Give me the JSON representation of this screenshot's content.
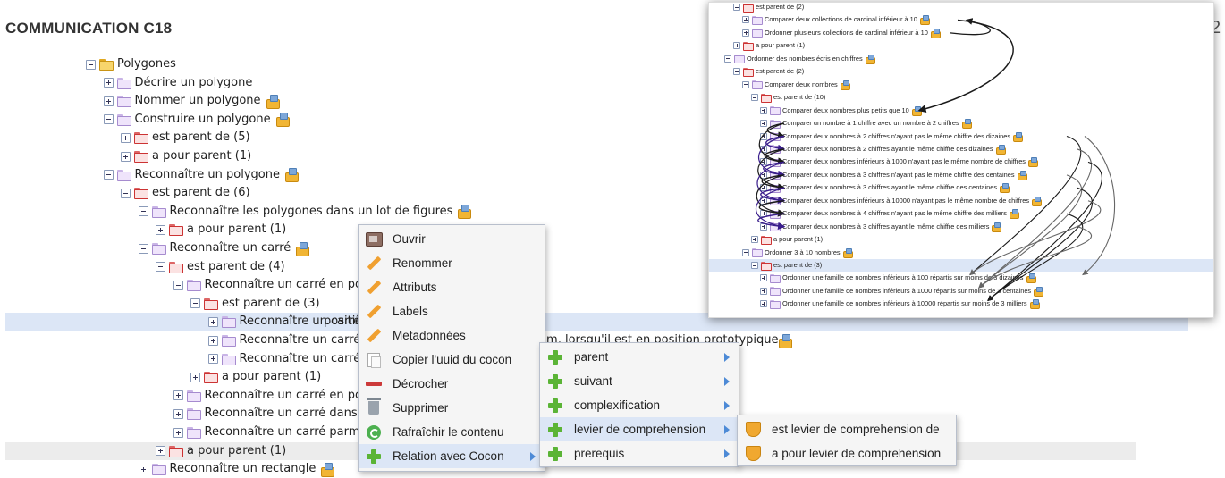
{
  "header": {
    "title": "COMMUNICATION C18",
    "page_number": "2"
  },
  "tree": [
    {
      "label": "Polygones",
      "toggle": "minus",
      "folder": "yellow",
      "badge": false,
      "level": 0
    },
    {
      "label": "Décrire un polygone",
      "toggle": "plus",
      "folder": "lilac",
      "badge": false,
      "level": 1
    },
    {
      "label": "Nommer un polygone",
      "toggle": "plus",
      "folder": "lilac",
      "badge": true,
      "level": 1
    },
    {
      "label": "Construire un polygone",
      "toggle": "minus",
      "folder": "lilac",
      "badge": true,
      "level": 1
    },
    {
      "label": "est parent de (5)",
      "toggle": "plus",
      "folder": "red",
      "badge": false,
      "level": 2
    },
    {
      "label": "a pour parent (1)",
      "toggle": "plus",
      "folder": "red",
      "badge": false,
      "level": 2
    },
    {
      "label": "Reconnaître un polygone",
      "toggle": "minus",
      "folder": "lilac",
      "badge": true,
      "level": 1
    },
    {
      "label": "est parent de (6)",
      "toggle": "minus",
      "folder": "red",
      "badge": false,
      "level": 2
    },
    {
      "label": "Reconnaître les polygones dans un lot de figures",
      "toggle": "minus",
      "folder": "lilac",
      "badge": true,
      "level": 3
    },
    {
      "label": "a pour parent (1)",
      "toggle": "plus",
      "folder": "red",
      "badge": false,
      "level": 4
    },
    {
      "label": "Reconnaître un carré",
      "toggle": "minus",
      "folder": "lilac",
      "badge": true,
      "level": 3
    },
    {
      "label": "est parent de (4)",
      "toggle": "minus",
      "folder": "red",
      "badge": false,
      "level": 4
    },
    {
      "label": "Reconnaître un carré en positition",
      "toggle": "minus",
      "folder": "lilac",
      "badge": false,
      "level": 5
    },
    {
      "label": "est parent de (3)",
      "toggle": "minus",
      "folder": "red",
      "badge": false,
      "level": 6
    },
    {
      "label": "Reconnaître un carré dans",
      "toggle": "plus",
      "folder": "lilac",
      "badge": false,
      "level": 7,
      "selected": true,
      "tail": "position prototypique",
      "tail_badge": true
    },
    {
      "label": "Reconnaître un carré dans",
      "toggle": "plus",
      "folder": "lilac",
      "badge": false,
      "level": 7,
      "tail": "agram, lorsqu'il est en position prototypique",
      "tail_badge": true
    },
    {
      "label": "Reconnaître un carré dans",
      "toggle": "plus",
      "folder": "lilac",
      "badge": false,
      "level": 7
    },
    {
      "label": "a pour parent (1)",
      "toggle": "plus",
      "folder": "red",
      "badge": false,
      "level": 6
    },
    {
      "label": "Reconnaître un carré en positition",
      "toggle": "plus",
      "folder": "lilac",
      "badge": false,
      "level": 5
    },
    {
      "label": "Reconnaître un carré dans une f",
      "toggle": "plus",
      "folder": "lilac",
      "badge": false,
      "level": 5
    },
    {
      "label": "Reconnaître un carré parmi des",
      "toggle": "plus",
      "folder": "lilac",
      "badge": false,
      "level": 5
    },
    {
      "label": "a pour parent (1)",
      "toggle": "plus",
      "folder": "red",
      "badge": false,
      "level": 4,
      "hover": true
    },
    {
      "label": "Reconnaître un rectangle",
      "toggle": "plus",
      "folder": "lilac",
      "badge": true,
      "level": 3
    }
  ],
  "context_menu": {
    "items": [
      {
        "label": "Ouvrir",
        "icon": "open-icon"
      },
      {
        "label": "Renommer",
        "icon": "pencil-icon"
      },
      {
        "label": "Attributs",
        "icon": "pencil-icon"
      },
      {
        "label": "Labels",
        "icon": "pencil-icon"
      },
      {
        "label": "Metadonnées",
        "icon": "pencil-icon"
      },
      {
        "label": "Copier l'uuid du cocon",
        "icon": "copy-icon"
      },
      {
        "label": "Décrocher",
        "icon": "minus-icon"
      },
      {
        "label": "Supprimer",
        "icon": "trash-icon"
      },
      {
        "label": "Rafraîchir le contenu",
        "icon": "refresh-icon"
      },
      {
        "label": "Relation avec Cocon",
        "icon": "plus-icon",
        "submenu": true,
        "highlight": true
      }
    ]
  },
  "relation_submenu": {
    "items": [
      {
        "label": "parent",
        "icon": "plus-icon",
        "submenu": true
      },
      {
        "label": "suivant",
        "icon": "plus-icon",
        "submenu": true
      },
      {
        "label": "complexification",
        "icon": "plus-icon",
        "submenu": true
      },
      {
        "label": "levier de comprehension",
        "icon": "plus-icon",
        "submenu": true,
        "highlight": true
      },
      {
        "label": "prerequis",
        "icon": "plus-icon",
        "submenu": true
      }
    ]
  },
  "levier_submenu": {
    "items": [
      {
        "label": "est levier de comprehension de",
        "icon": "shield-icon"
      },
      {
        "label": "a pour levier de comprehension",
        "icon": "shield-icon"
      }
    ]
  },
  "inset_tree": [
    {
      "label": "est parent de (2)",
      "toggle": "minus",
      "folder": "red",
      "badge": false,
      "level": 1
    },
    {
      "label": "Comparer deux collections de cardinal inférieur à 10",
      "toggle": "plus",
      "folder": "lilac",
      "badge": true,
      "level": 2
    },
    {
      "label": "Ordonner plusieurs collections de cardinal inférieur à 10",
      "toggle": "plus",
      "folder": "lilac",
      "badge": true,
      "level": 2
    },
    {
      "label": "a pour parent (1)",
      "toggle": "plus",
      "folder": "red",
      "badge": false,
      "level": 1
    },
    {
      "label": "Ordonner des nombres écris en chiffres",
      "toggle": "minus",
      "folder": "lilac",
      "badge": true,
      "level": 0
    },
    {
      "label": "est parent de (2)",
      "toggle": "minus",
      "folder": "red",
      "badge": false,
      "level": 1
    },
    {
      "label": "Comparer deux nombres",
      "toggle": "minus",
      "folder": "lilac",
      "badge": true,
      "level": 2
    },
    {
      "label": "est parent de (10)",
      "toggle": "minus",
      "folder": "red",
      "badge": false,
      "level": 3
    },
    {
      "label": "Comparer deux nombres plus petits que 10",
      "toggle": "plus",
      "folder": "lilac",
      "badge": true,
      "level": 4
    },
    {
      "label": "Comparer un nombre à 1 chiffre avec un nombre à 2 chiffres",
      "toggle": "plus",
      "folder": "lilac",
      "badge": true,
      "level": 4
    },
    {
      "label": "Comparer deux nombres à 2 chiffres n'ayant pas le même chiffre des dizaines",
      "toggle": "plus",
      "folder": "lilac",
      "badge": true,
      "level": 4
    },
    {
      "label": "Comparer deux nombres à 2 chiffres ayant le même chiffre des dizaines",
      "toggle": "plus",
      "folder": "lilac",
      "badge": true,
      "level": 4
    },
    {
      "label": "Comparer deux nombres inférieurs à 1000 n'ayant pas le même nombre de chiffres",
      "toggle": "plus",
      "folder": "lilac",
      "badge": true,
      "level": 4
    },
    {
      "label": "Comparer deux nombres à 3 chiffres n'ayant pas le même chiffre des centaines",
      "toggle": "plus",
      "folder": "lilac",
      "badge": true,
      "level": 4
    },
    {
      "label": "Comparer deux nombres à 3 chiffres ayant le même chiffre des centaines",
      "toggle": "plus",
      "folder": "lilac",
      "badge": true,
      "level": 4
    },
    {
      "label": "Comparer deux nombres inférieurs à 10000 n'ayant pas le même nombre de chiffres",
      "toggle": "plus",
      "folder": "lilac",
      "badge": true,
      "level": 4
    },
    {
      "label": "Comparer deux nombres à 4 chiffres n'ayant pas le même chiffre des milliers",
      "toggle": "plus",
      "folder": "lilac",
      "badge": true,
      "level": 4
    },
    {
      "label": "Comparer deux nombres à 3 chiffres ayant le même chiffre des milliers",
      "toggle": "plus",
      "folder": "lilac",
      "badge": true,
      "level": 4
    },
    {
      "label": "a pour parent (1)",
      "toggle": "plus",
      "folder": "red",
      "badge": false,
      "level": 3
    },
    {
      "label": "Ordonner 3 à 10 nombres",
      "toggle": "minus",
      "folder": "lilac",
      "badge": true,
      "level": 2
    },
    {
      "label": "est parent de (3)",
      "toggle": "minus",
      "folder": "red",
      "badge": false,
      "level": 3,
      "selected": true
    },
    {
      "label": "Ordonner une famille de nombres inférieurs à 100 répartis sur moins de 3 dizaines",
      "toggle": "plus",
      "folder": "lilac",
      "badge": true,
      "level": 4
    },
    {
      "label": "Ordonner une famille de nombres inférieurs à 1000 répartis sur moins de 3 centaines",
      "toggle": "plus",
      "folder": "lilac",
      "badge": true,
      "level": 4
    },
    {
      "label": "Ordonner une famille de nombres inférieurs à 10000 répartis sur moins de 3 milliers",
      "toggle": "plus",
      "folder": "lilac",
      "badge": true,
      "level": 4
    }
  ],
  "colors": {
    "selection": "#dce6f6",
    "menu_bg": "#f5f5f5",
    "arrow_dark": "#1a1a1a",
    "arrow_purple": "#3a1e8c",
    "arrow_gray": "#666666"
  }
}
